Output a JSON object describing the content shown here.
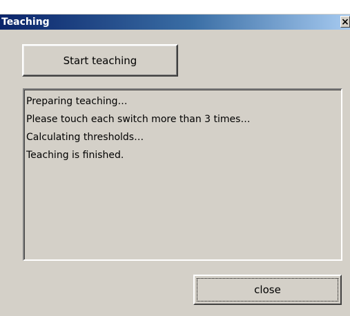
{
  "window": {
    "title": "Teaching",
    "close_glyph": "×"
  },
  "buttons": {
    "start_label": "Start teaching",
    "close_label": "close"
  },
  "log": {
    "lines": [
      "Preparing teaching…",
      "Please touch each switch more than 3 times…",
      "Calculating thresholds…",
      "Teaching is finished."
    ]
  },
  "colors": {
    "dialog_face": "#d4d0c8",
    "titlebar_start": "#0a246a",
    "titlebar_end": "#a6caf0"
  },
  "icons": {
    "close": "close-icon"
  }
}
